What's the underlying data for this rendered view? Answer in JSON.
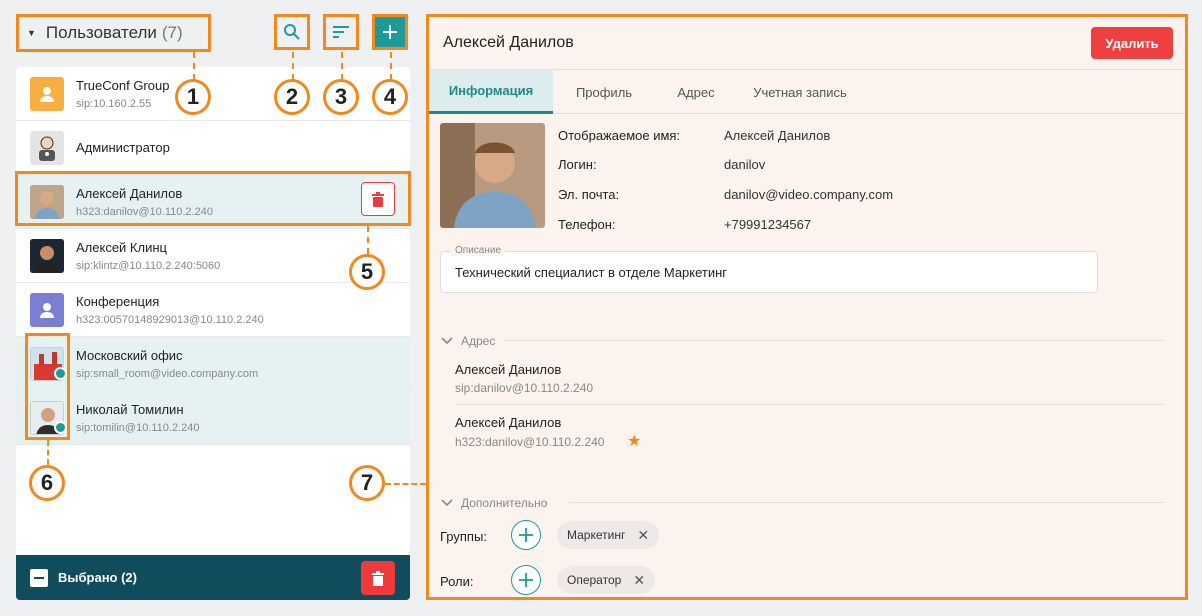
{
  "sidebar": {
    "title": "Пользователи",
    "count": "(7)",
    "items": [
      {
        "name": "TrueConf Group",
        "sub": "sip:10.160.2.55"
      },
      {
        "name": "Администратор",
        "sub": ""
      },
      {
        "name": "Алексей Данилов",
        "sub": "h323:danilov@10.110.2.240"
      },
      {
        "name": "Алексей Клинц",
        "sub": "sip:klintz@10.110.2.240:5060"
      },
      {
        "name": "Конференция",
        "sub": "h323:00570148929013@10.110.2.240"
      },
      {
        "name": "Московский офис",
        "sub": "sip:small_room@video.company.com"
      },
      {
        "name": "Николай Томилин",
        "sub": "sip:tomilin@10.110.2.240"
      }
    ],
    "footer": "Выбрано (2)"
  },
  "callouts": [
    "1",
    "2",
    "3",
    "4",
    "5",
    "6",
    "7"
  ],
  "detail": {
    "title": "Алексей Данилов",
    "delete_label": "Удалить",
    "tabs": [
      "Информация",
      "Профиль",
      "Адрес",
      "Учетная запись"
    ],
    "fields": [
      {
        "label": "Отображаемое имя:",
        "value": "Алексей Данилов"
      },
      {
        "label": "Логин:",
        "value": "danilov"
      },
      {
        "label": "Эл. почта:",
        "value": "danilov@video.company.com"
      },
      {
        "label": "Телефон:",
        "value": "+79991234567"
      }
    ],
    "description_label": "Описание",
    "description": "Технический специалист в отделе Маркетинг",
    "address_section": "Адрес",
    "addresses": [
      {
        "name": "Алексей Данилов",
        "sub": "sip:danilov@10.110.2.240"
      },
      {
        "name": "Алексей Данилов",
        "sub": "h323:danilov@10.110.2.240"
      }
    ],
    "extra_section": "Дополнительно",
    "groups_label": "Группы:",
    "groups": [
      "Маркетинг"
    ],
    "roles_label": "Роли:",
    "roles": [
      "Оператор"
    ]
  },
  "colors": {
    "accent": "#1e9a9a",
    "danger": "#ee3a3a",
    "callout": "#f0891e",
    "footer": "#0f4c5c",
    "star": "#f0891e"
  }
}
